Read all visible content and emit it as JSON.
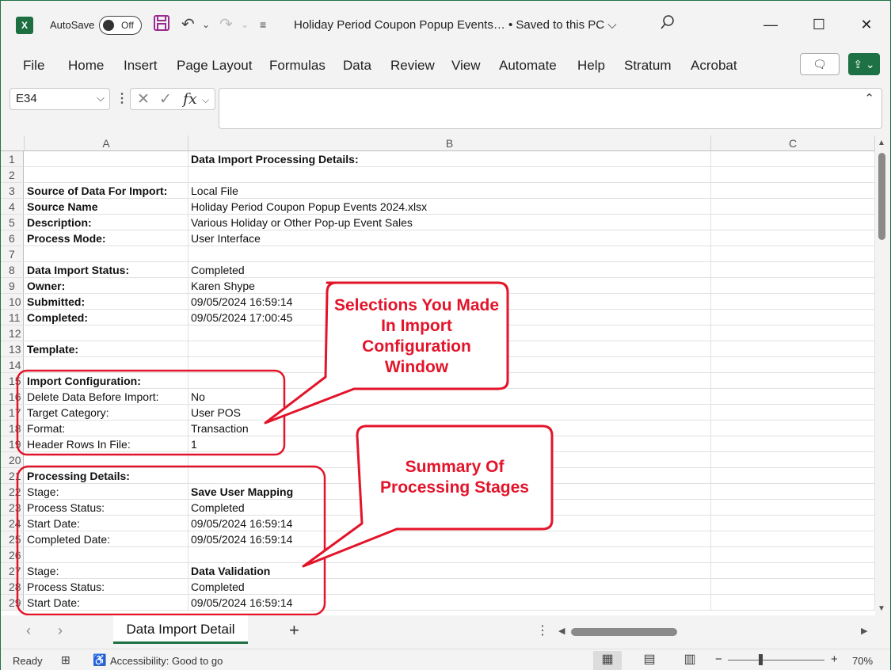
{
  "titlebar": {
    "autosave_label": "AutoSave",
    "autosave_state": "Off",
    "document_title": "Holiday Period Coupon Popup Events…  •  Saved to this PC ⌵"
  },
  "ribbon": {
    "tabs": [
      "File",
      "Home",
      "Insert",
      "Page Layout",
      "Formulas",
      "Data",
      "Review",
      "View",
      "Automate",
      "Help",
      "Stratum",
      "Acrobat"
    ]
  },
  "formula_bar": {
    "name_box": "E34",
    "formula": ""
  },
  "grid": {
    "columns": [
      "A",
      "B",
      "C"
    ],
    "rows": [
      {
        "n": "1",
        "a": "",
        "b": "Data Import Processing Details:",
        "a_bold": false,
        "b_bold": true
      },
      {
        "n": "2",
        "a": "",
        "b": "",
        "a_bold": false,
        "b_bold": false
      },
      {
        "n": "3",
        "a": "Source of Data For Import:",
        "b": "Local File",
        "a_bold": true,
        "b_bold": false
      },
      {
        "n": "4",
        "a": "Source Name",
        "b": "Holiday Period Coupon Popup Events 2024.xlsx",
        "a_bold": true,
        "b_bold": false
      },
      {
        "n": "5",
        "a": "Description:",
        "b": "Various Holiday or Other Pop-up Event Sales",
        "a_bold": true,
        "b_bold": false
      },
      {
        "n": "6",
        "a": "Process Mode:",
        "b": "User Interface",
        "a_bold": true,
        "b_bold": false
      },
      {
        "n": "7",
        "a": "",
        "b": "",
        "a_bold": false,
        "b_bold": false
      },
      {
        "n": "8",
        "a": "Data Import Status:",
        "b": "Completed",
        "a_bold": true,
        "b_bold": false
      },
      {
        "n": "9",
        "a": "Owner:",
        "b": "Karen Shype",
        "a_bold": true,
        "b_bold": false
      },
      {
        "n": "10",
        "a": "Submitted:",
        "b": "09/05/2024 16:59:14",
        "a_bold": true,
        "b_bold": false
      },
      {
        "n": "11",
        "a": "Completed:",
        "b": "09/05/2024 17:00:45",
        "a_bold": true,
        "b_bold": false
      },
      {
        "n": "12",
        "a": "",
        "b": "",
        "a_bold": false,
        "b_bold": false
      },
      {
        "n": "13",
        "a": "Template:",
        "b": "",
        "a_bold": true,
        "b_bold": false
      },
      {
        "n": "14",
        "a": "",
        "b": "",
        "a_bold": false,
        "b_bold": false
      },
      {
        "n": "15",
        "a": "Import Configuration:",
        "b": "",
        "a_bold": true,
        "b_bold": false
      },
      {
        "n": "16",
        "a": "Delete Data Before Import:",
        "b": "No",
        "a_bold": false,
        "b_bold": false
      },
      {
        "n": "17",
        "a": "Target Category:",
        "b": "User POS",
        "a_bold": false,
        "b_bold": false
      },
      {
        "n": "18",
        "a": "Format:",
        "b": "Transaction",
        "a_bold": false,
        "b_bold": false
      },
      {
        "n": "19",
        "a": "Header Rows In File:",
        "b": "1",
        "a_bold": false,
        "b_bold": false
      },
      {
        "n": "20",
        "a": "",
        "b": "",
        "a_bold": false,
        "b_bold": false
      },
      {
        "n": "21",
        "a": "Processing Details:",
        "b": "",
        "a_bold": true,
        "b_bold": false
      },
      {
        "n": "22",
        "a": "Stage:",
        "b": "Save User Mapping",
        "a_bold": false,
        "b_bold": true
      },
      {
        "n": "23",
        "a": "Process Status:",
        "b": "Completed",
        "a_bold": false,
        "b_bold": false
      },
      {
        "n": "24",
        "a": "Start Date:",
        "b": "09/05/2024 16:59:14",
        "a_bold": false,
        "b_bold": false
      },
      {
        "n": "25",
        "a": "Completed Date:",
        "b": "09/05/2024 16:59:14",
        "a_bold": false,
        "b_bold": false
      },
      {
        "n": "26",
        "a": "",
        "b": "",
        "a_bold": false,
        "b_bold": false
      },
      {
        "n": "27",
        "a": "Stage:",
        "b": "Data Validation",
        "a_bold": false,
        "b_bold": true
      },
      {
        "n": "28",
        "a": "Process Status:",
        "b": "Completed",
        "a_bold": false,
        "b_bold": false
      },
      {
        "n": "29",
        "a": "Start Date:",
        "b": "09/05/2024 16:59:14",
        "a_bold": false,
        "b_bold": false
      }
    ]
  },
  "callouts": {
    "import_config": "Selections You Made In Import Configuration Window",
    "processing": "Summary Of Processing Stages"
  },
  "sheets": {
    "active": "Data Import Detail"
  },
  "statusbar": {
    "ready": "Ready",
    "accessibility": "Accessibility: Good to go",
    "zoom": "70%"
  },
  "colors": {
    "excel_green": "#1e7145",
    "callout_red": "#e3142a"
  }
}
